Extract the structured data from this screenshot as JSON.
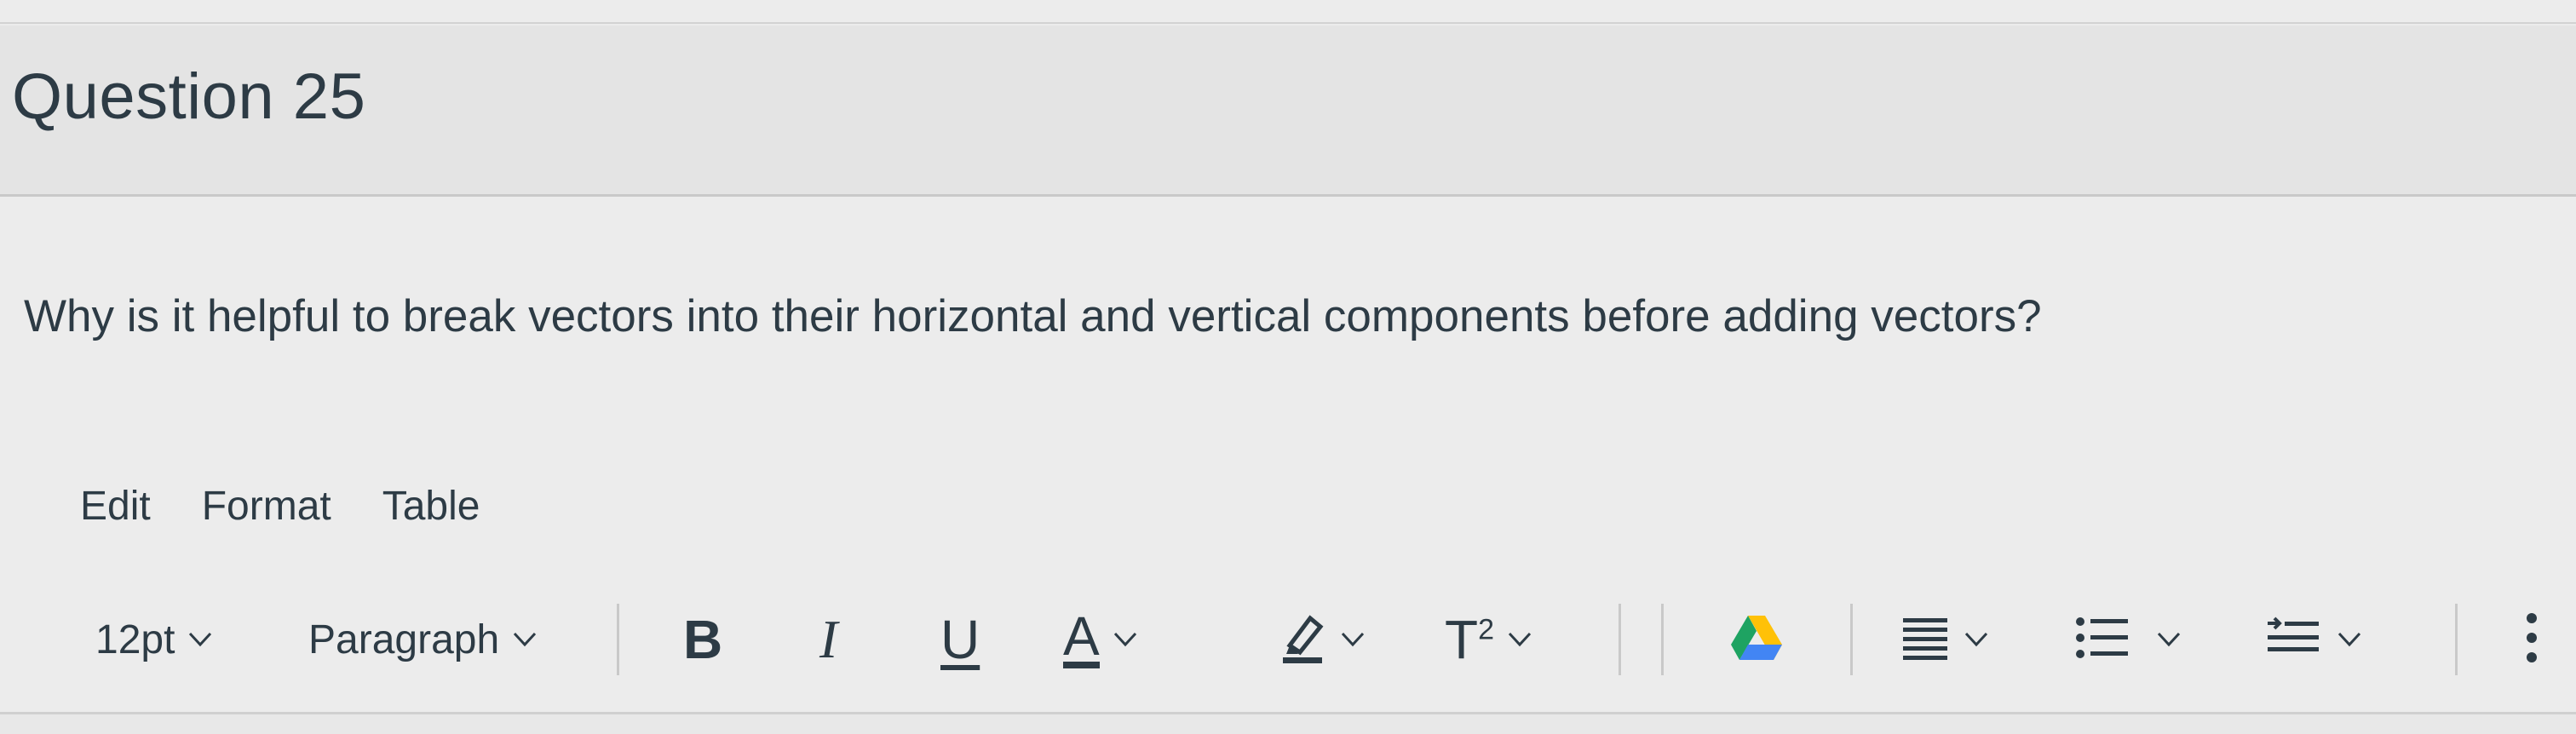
{
  "question": {
    "title": "Question 25",
    "text": "Why is it helpful to break vectors into their horizontal and vertical components before adding vectors?"
  },
  "editor": {
    "menu": [
      "Edit",
      "Format",
      "Table"
    ],
    "toolbar": {
      "font_size": "12pt",
      "block_format": "Paragraph",
      "bold_glyph": "B",
      "italic_glyph": "I",
      "underline_glyph": "U",
      "text_color_glyph": "A",
      "superscript_glyph": "T",
      "superscript_mark": "2"
    },
    "icons": [
      "chevron-down-icon",
      "highlighter-icon",
      "google-drive-icon",
      "align-icon",
      "bullet-list-icon",
      "indent-icon",
      "more-options-icon"
    ],
    "colors": {
      "text": "#2d3b45",
      "drive_green": "#1ea362",
      "drive_yellow": "#ffc107",
      "drive_blue": "#4285f4"
    }
  }
}
